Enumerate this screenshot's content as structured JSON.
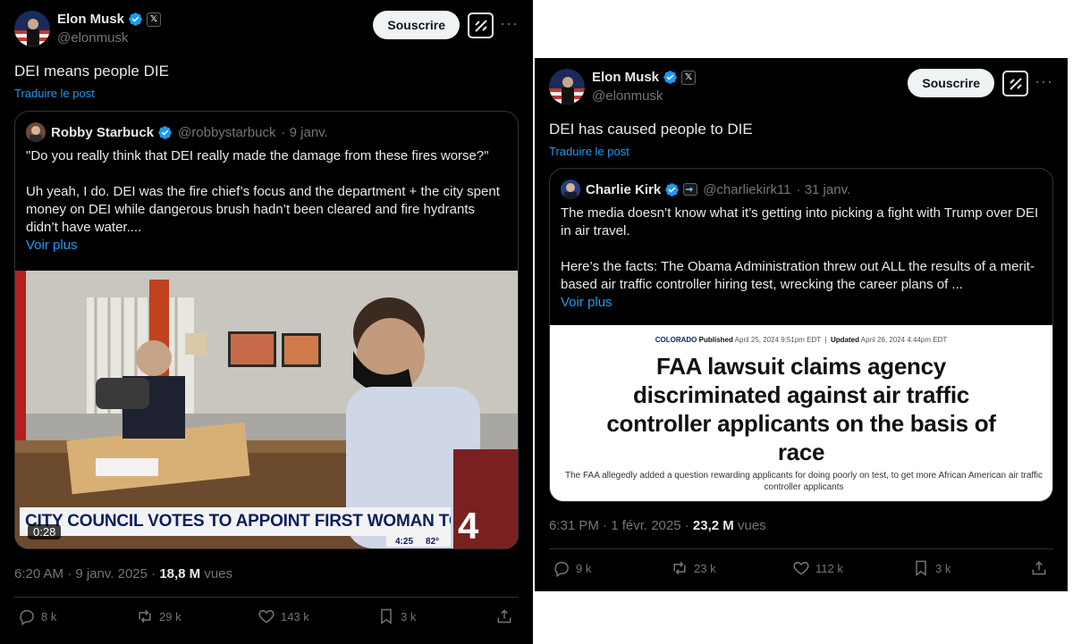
{
  "left": {
    "author": {
      "name": "Elon Musk",
      "handle": "@elonmusk",
      "badge": "𝕏"
    },
    "subscribe_label": "Souscrire",
    "more_label": "···",
    "text": "DEI means people DIE",
    "translate_label": "Traduire le post",
    "quote": {
      "name": "Robby Starbuck",
      "handle": "@robbystarbuck",
      "date": "· 9 janv.",
      "p1": "\"Do you really think that DEI really made the damage from these fires worse?\"",
      "p2": "Uh yeah, I do. DEI was the fire chief’s focus and the department + the city spent money on DEI while dangerous brush hadn’t been cleared and fire hydrants didn’t have water....",
      "see_more": "Voir plus",
      "video": {
        "duration": "0:28",
        "caption": "CITY COUNCIL VOTES TO APPOINT FIRST WOMAN TO LEAD LAFD",
        "time": "4:25",
        "temp": "82°",
        "channel": "4"
      }
    },
    "meta": {
      "time": "6:20 AM · 9 janv. 2025 · ",
      "views": "18,8 M",
      "views_label": " vues"
    },
    "actions": {
      "replies": "8 k",
      "reposts": "29 k",
      "likes": "143 k",
      "bookmarks": "3 k"
    }
  },
  "right": {
    "author": {
      "name": "Elon Musk",
      "handle": "@elonmusk",
      "badge": "𝕏"
    },
    "subscribe_label": "Souscrire",
    "more_label": "···",
    "text": "DEI has caused people to DIE",
    "translate_label": "Traduire le post",
    "quote": {
      "name": "Charlie Kirk",
      "handle": "@charliekirk11",
      "date": "· 31 janv.",
      "p1": "The media doesn’t know what it’s getting into picking a fight with Trump over DEI in air travel.",
      "p2": "Here’s the facts: The Obama Administration threw out ALL the results of a merit-based air traffic controller hiring test, wrecking the career plans of ...",
      "see_more": "Voir plus",
      "article": {
        "category": "COLORADO",
        "published_label": "Published",
        "published": "April 25, 2024 9:51pm EDT",
        "updated_label": "Updated",
        "updated": "April 26, 2024 4:44pm EDT",
        "headline": "FAA lawsuit claims agency discriminated against air traffic controller applicants on the basis of race",
        "subhead": "The FAA allegedly added a question rewarding applicants for doing poorly on test, to get more African American air traffic controller applicants"
      }
    },
    "meta": {
      "time": "6:31 PM · 1 févr. 2025 · ",
      "views": "23,2 M",
      "views_label": " vues"
    },
    "actions": {
      "replies": "9 k",
      "reposts": "23 k",
      "likes": "112 k",
      "bookmarks": "3 k"
    }
  },
  "colors": {
    "background": "#000000",
    "text": "#e7e9ea",
    "muted": "#71767b",
    "link": "#1d9bf0",
    "verified": "#1d9bf0",
    "border": "#2f3336"
  }
}
